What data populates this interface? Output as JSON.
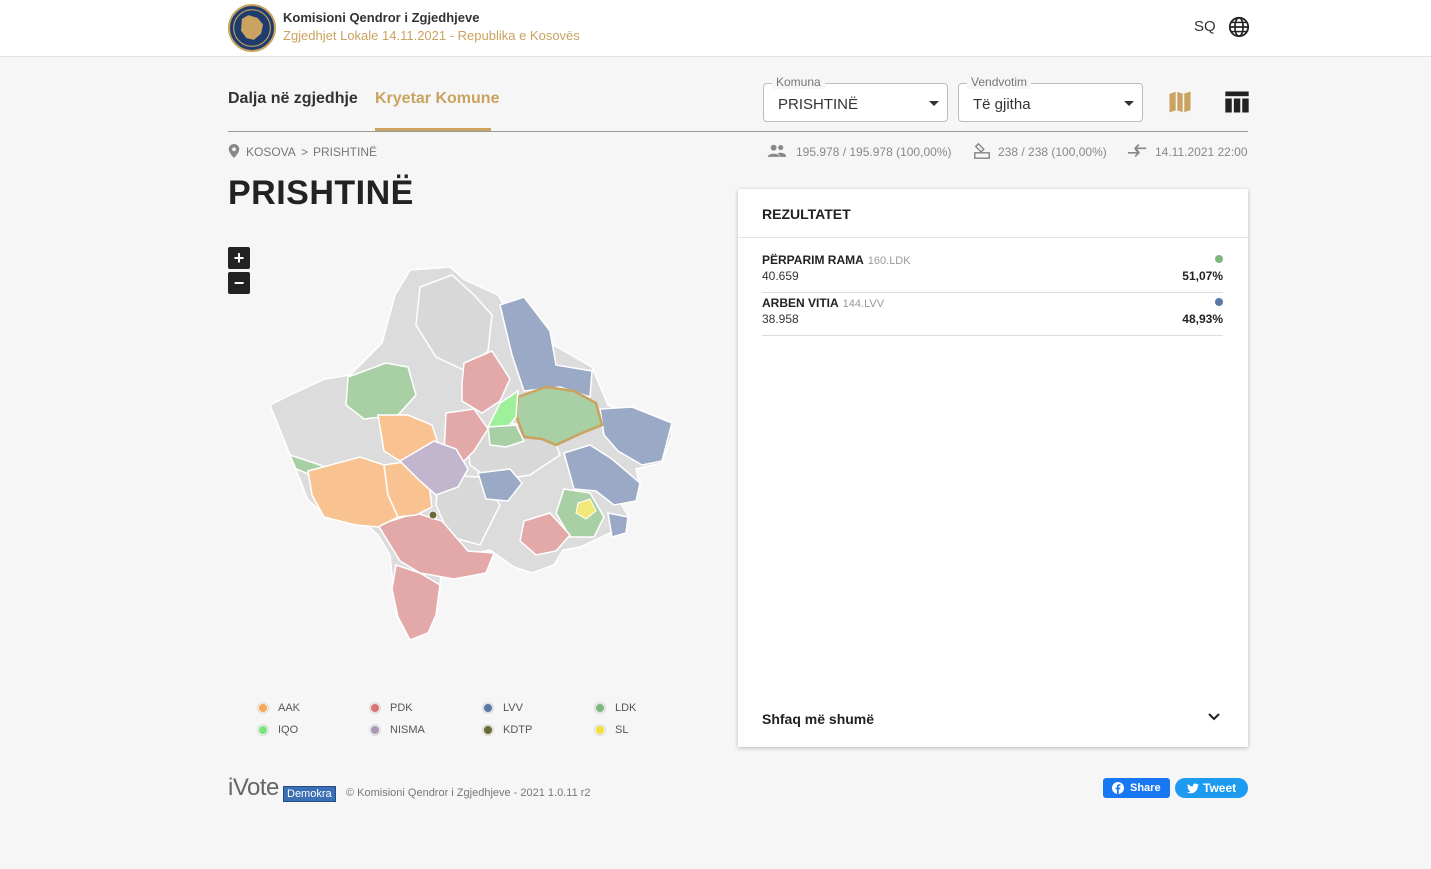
{
  "header": {
    "org_name": "Komisioni Qendror i Zgjedhjeve",
    "subtitle": "Zgjedhjet Lokale 14.11.2021 - Republika e Kosovës",
    "language": "SQ",
    "icons": {
      "logo": "kqz-emblem",
      "language": "globe-icon"
    }
  },
  "tabs": [
    {
      "label": "Dalja në zgjedhje",
      "active": false
    },
    {
      "label": "Kryetar Komune",
      "active": true
    }
  ],
  "filters": {
    "municipality": {
      "label": "Komuna",
      "value": "PRISHTINË"
    },
    "polling_place": {
      "label": "Vendvotim",
      "value": "Të gjitha"
    }
  },
  "view_buttons": {
    "map": "map-icon",
    "table": "table-icon"
  },
  "breadcrumb": {
    "items": [
      "KOSOVA",
      "PRISHTINË"
    ],
    "separator": ">"
  },
  "stats": {
    "voters": "195.978 / 195.978 (100,00%)",
    "stations": "238 / 238 (100,00%)",
    "updated": "14.11.2021 22:00"
  },
  "page_title": "PRISHTINË",
  "map": {
    "zoom_in": "+",
    "zoom_out": "−",
    "legend": [
      {
        "label": "AAK",
        "color": "#f9a85a"
      },
      {
        "label": "PDK",
        "color": "#d97474"
      },
      {
        "label": "LVV",
        "color": "#5d77a8"
      },
      {
        "label": "LDK",
        "color": "#7db77d"
      },
      {
        "label": "IQO",
        "color": "#7de27d"
      },
      {
        "label": "NISMA",
        "color": "#a797b5"
      },
      {
        "label": "KDTP",
        "color": "#6b6b3a"
      },
      {
        "label": "SL",
        "color": "#f2de3a"
      }
    ]
  },
  "results": {
    "title": "REZULTATET",
    "candidates": [
      {
        "name": "PËRPARIM RAMA",
        "party": "160.LDK",
        "votes": "40.659",
        "percent": "51,07%",
        "color": "#7db77d"
      },
      {
        "name": "ARBEN VITIA",
        "party": "144.LVV",
        "votes": "38.958",
        "percent": "48,93%",
        "color": "#5d77a8"
      }
    ],
    "show_more": "Shfaq më shumë"
  },
  "footer": {
    "brand": "iVote",
    "brand_tag": "Demokra",
    "copyright": "© Komisioni Qendror i Zgjedhjeve - 2021 1.0.11 r2",
    "share": "Share",
    "tweet": "Tweet"
  }
}
